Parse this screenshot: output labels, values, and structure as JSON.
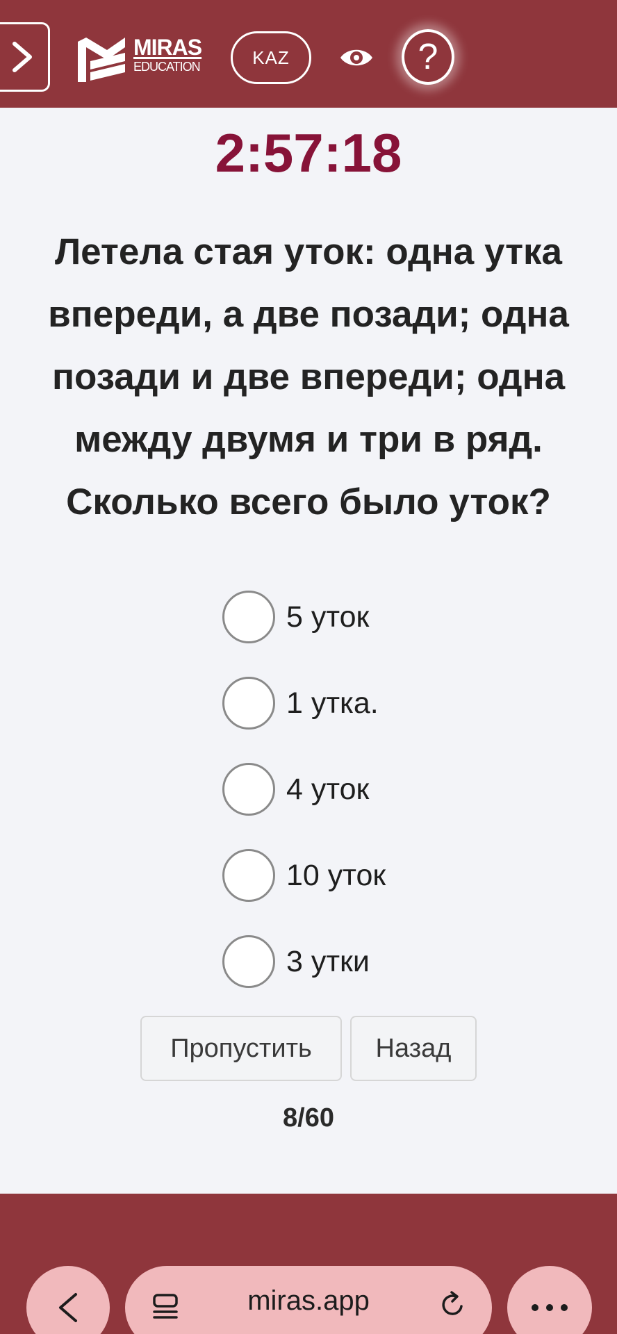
{
  "colors": {
    "brand": "#8f363c",
    "timer": "#871338",
    "browser_button": "#f1b9bc",
    "background": "#f3f4f8"
  },
  "header": {
    "menu_icon": "chevron-right-icon",
    "logo": {
      "name": "MIRAS",
      "subtitle": "EDUCATION"
    },
    "language_button": "KAZ",
    "visibility_icon": "eye-icon",
    "help_button": "?"
  },
  "quiz": {
    "timer": "2:57:18",
    "question": "Летела стая уток: одна утка впереди, а две позади; одна позади и две впереди; одна между двумя и три в ряд. Сколько всего было уток?",
    "options": [
      {
        "label": "5 уток",
        "selected": false
      },
      {
        "label": "1 утка.",
        "selected": false
      },
      {
        "label": "4 уток",
        "selected": false
      },
      {
        "label": "10 уток",
        "selected": false
      },
      {
        "label": "3 утки",
        "selected": false
      }
    ],
    "skip_button": "Пропустить",
    "back_button": "Назад",
    "progress": "8/60"
  },
  "browser": {
    "url": "miras.app",
    "back_icon": "chevron-left-icon",
    "tabs_icon": "tabs-icon",
    "reload_icon": "reload-icon",
    "more_icon": "more-icon"
  }
}
